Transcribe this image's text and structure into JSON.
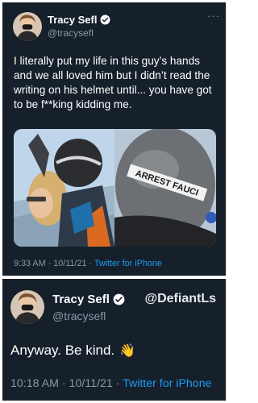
{
  "tweets": [
    {
      "author": {
        "name": "Tracy Sefl",
        "handle": "@tracysefl",
        "verified": true
      },
      "more_icon": "more-icon",
      "text": "I literally put my life in this guy’s hands and we all loved him but I didn’t read the writing on his helmet until... you have got to be f**king kidding me.",
      "media": [
        {
          "description": "skydiving-selfie"
        },
        {
          "description": "helmet-closeup",
          "helmet_text": "ARREST FAUCI"
        }
      ],
      "time": "9:33 AM · 10/11/21 · ",
      "source": "Twitter for iPhone"
    },
    {
      "author": {
        "name": "Tracy Sefl",
        "handle": "@tracysefl",
        "verified": true
      },
      "text": "Anyway. Be kind.",
      "emoji": "👋",
      "time": "10:18 AM · 10/11/21 · ",
      "source": "Twitter for iPhone",
      "watermark": "@DefiantLs"
    }
  ],
  "colors": {
    "background": "#15202b",
    "text": "#ffffff",
    "muted": "#8899a6",
    "link": "#1d9bf0"
  }
}
